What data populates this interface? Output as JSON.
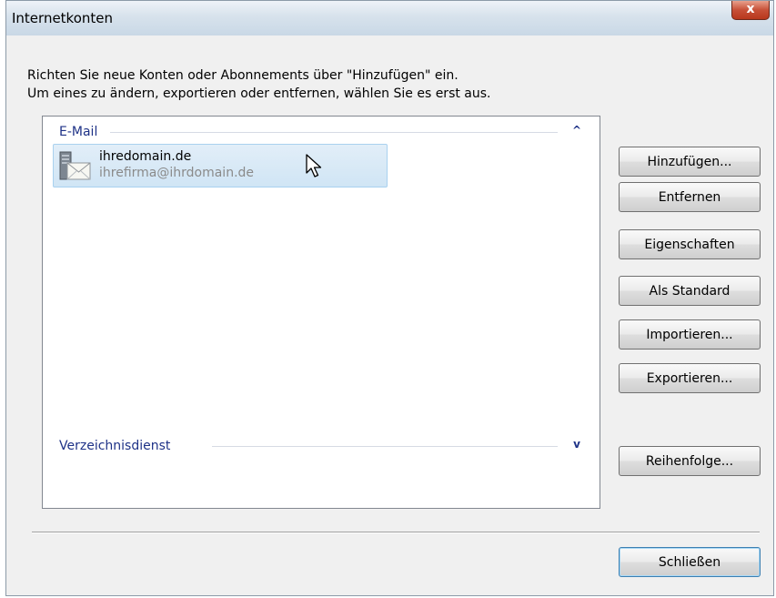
{
  "window": {
    "title": "Internetkonten",
    "close_label": "x"
  },
  "intro": {
    "text": "Richten Sie neue Konten oder Abonnements über \"Hinzufügen\" ein.\nUm eines zu ändern, exportieren oder entfernen, wählen Sie es erst aus."
  },
  "accounts": {
    "groups": [
      {
        "label": "E-Mail",
        "chevron": "^",
        "items": [
          {
            "name": "ihredomain.de",
            "email": "ihrefirma@ihrdomain.de",
            "icon": "mail-account-icon",
            "selected": true
          }
        ]
      },
      {
        "label": "Verzeichnisdienst",
        "chevron": "v",
        "items": []
      }
    ]
  },
  "buttons": {
    "add": "Hinzufügen...",
    "remove": "Entfernen",
    "properties": "Eigenschaften",
    "set_default": "Als Standard",
    "import": "Importieren...",
    "export": "Exportieren...",
    "order": "Reihenfolge...",
    "close": "Schließen"
  },
  "colors": {
    "group_header": "#1e3287",
    "selection_bg": "#d0e5f5",
    "selection_border": "#a9d1ef",
    "close_button": "#c75037"
  }
}
